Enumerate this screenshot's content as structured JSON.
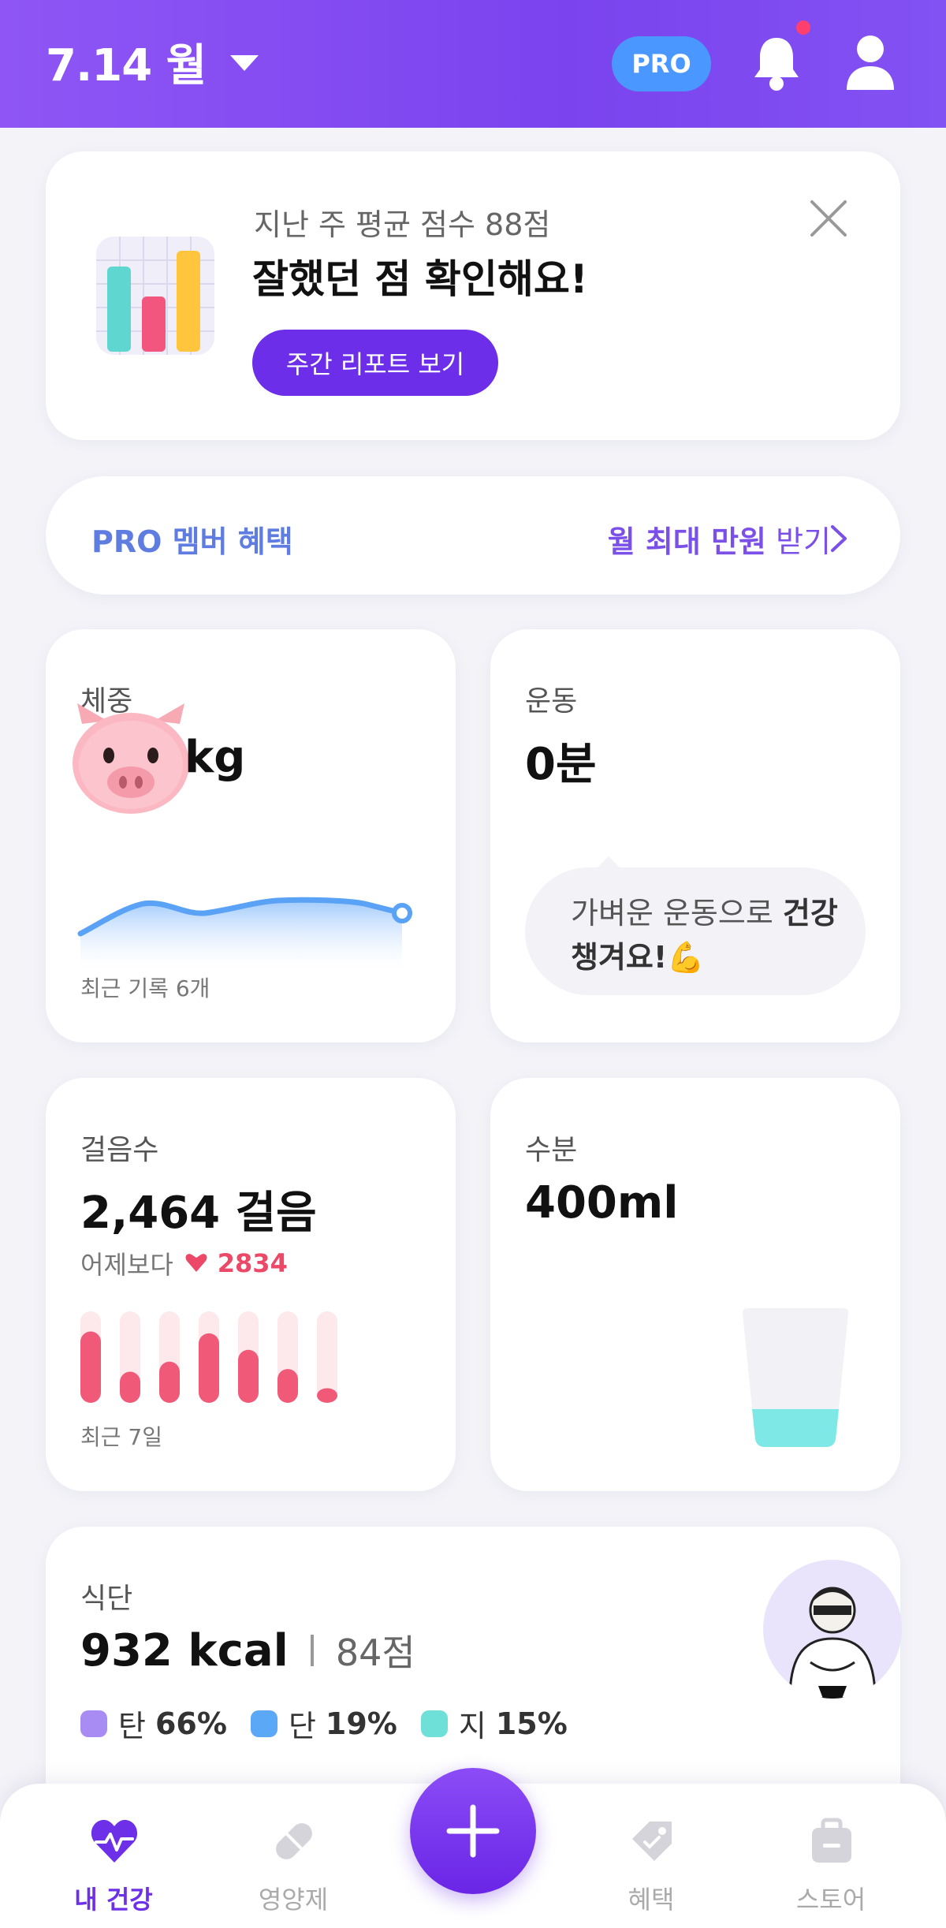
{
  "header": {
    "date": "7.14 월",
    "pro_badge": "PRO",
    "icons": [
      "chevron-down-icon",
      "bell-icon",
      "user-icon"
    ],
    "accent": "#7b46ef",
    "notification_dot": "#ff3f6e"
  },
  "report": {
    "subtitle": "지난 주 평균 점수 88점",
    "title": "잘했던 점 확인해요!",
    "button": "주간 리포트 보기",
    "icon": "bar-chart-icon",
    "close_icon": "close-icon"
  },
  "pro_banner": {
    "left": "PRO 멤버 혜택",
    "right_bold": "월 최대 만원",
    "right_light": " 받기",
    "icon": "chevron-right-icon"
  },
  "weight": {
    "label": "체중",
    "unit": "kg",
    "footer": "최근 기록 6개",
    "avatar": "pig-icon",
    "color": "#5aa2f5"
  },
  "exercise": {
    "label": "운동",
    "value": "0분",
    "bubble_1": "가벼운 운동으로 ",
    "bubble_bold": "건강 챙겨요!",
    "emoji": "💪"
  },
  "steps": {
    "label": "걸음수",
    "value": "2,464 걸음",
    "compare_label": "어제보다",
    "compare_value": "2834",
    "footer": "최근 7일",
    "bar_fill": [
      0.78,
      0.34,
      0.45,
      0.76,
      0.58,
      0.37,
      0.16
    ],
    "color": "#f05a78"
  },
  "water": {
    "label": "수분",
    "value": "400ml",
    "fill": 0.22,
    "color": "#7ee8e6"
  },
  "diet": {
    "label": "식단",
    "kcal": "932 kcal",
    "score": "84점",
    "macros": [
      {
        "name": "탄",
        "pct": "66%",
        "color": "#a98bf4"
      },
      {
        "name": "단",
        "pct": "19%",
        "color": "#5ba8f7"
      },
      {
        "name": "지",
        "pct": "15%",
        "color": "#6fe0d8"
      }
    ]
  },
  "tabbar": {
    "tabs": [
      {
        "label": "내 건강",
        "icon": "heart-pulse-icon"
      },
      {
        "label": "영양제",
        "icon": "pill-icon"
      },
      {
        "label": "혜택",
        "icon": "tag-icon"
      },
      {
        "label": "스토어",
        "icon": "store-bag-icon"
      }
    ],
    "fab_icon": "plus-icon"
  }
}
